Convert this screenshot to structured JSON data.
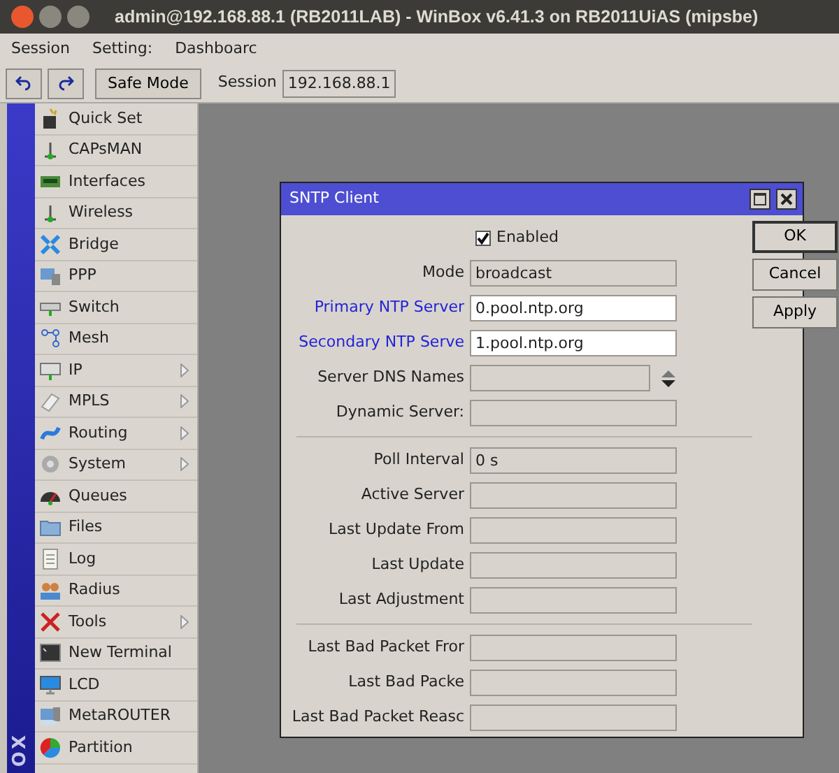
{
  "window": {
    "title": "admin@192.168.88.1 (RB2011LAB) - WinBox v6.41.3 on RB2011UiAS (mipsbe)"
  },
  "menu_bar": [
    "Session",
    "Setting:",
    "Dashboarc"
  ],
  "toolbar": {
    "safe_mode": "Safe Mode",
    "session_label": "Session",
    "session_value": "192.168.88.1"
  },
  "side_strip": {
    "text": "OX"
  },
  "sidebar": {
    "items": [
      {
        "label": "Quick Set",
        "submenu": false
      },
      {
        "label": "CAPsMAN",
        "submenu": false
      },
      {
        "label": "Interfaces",
        "submenu": false
      },
      {
        "label": "Wireless",
        "submenu": false
      },
      {
        "label": "Bridge",
        "submenu": false
      },
      {
        "label": "PPP",
        "submenu": false
      },
      {
        "label": "Switch",
        "submenu": false
      },
      {
        "label": "Mesh",
        "submenu": false
      },
      {
        "label": "IP",
        "submenu": true
      },
      {
        "label": "MPLS",
        "submenu": true
      },
      {
        "label": "Routing",
        "submenu": true
      },
      {
        "label": "System",
        "submenu": true
      },
      {
        "label": "Queues",
        "submenu": false
      },
      {
        "label": "Files",
        "submenu": false
      },
      {
        "label": "Log",
        "submenu": false
      },
      {
        "label": "Radius",
        "submenu": false
      },
      {
        "label": "Tools",
        "submenu": true
      },
      {
        "label": "New Terminal",
        "submenu": false
      },
      {
        "label": "LCD",
        "submenu": false
      },
      {
        "label": "MetaROUTER",
        "submenu": false
      },
      {
        "label": "Partition",
        "submenu": false
      }
    ]
  },
  "dialog": {
    "title": "SNTP Client",
    "enabled": {
      "label": "Enabled",
      "checked": true
    },
    "groups": [
      [
        {
          "label": "Mode",
          "value": "broadcast",
          "editable": false,
          "highlighted": false,
          "kind": "text"
        },
        {
          "label": "Primary NTP Server",
          "value": "0.pool.ntp.org",
          "editable": true,
          "highlighted": true,
          "kind": "text"
        },
        {
          "label": "Secondary NTP Serve",
          "value": "1.pool.ntp.org",
          "editable": true,
          "highlighted": true,
          "kind": "text"
        },
        {
          "label": "Server DNS Names",
          "editable": false,
          "highlighted": false,
          "kind": "list"
        },
        {
          "label": "Dynamic Server:",
          "editable": false,
          "highlighted": false,
          "kind": "text"
        }
      ],
      [
        {
          "label": "Poll Interval",
          "value": "0 s",
          "editable": false,
          "highlighted": false,
          "kind": "text"
        },
        {
          "label": "Active Server",
          "editable": false,
          "highlighted": false,
          "kind": "text"
        },
        {
          "label": "Last Update From",
          "editable": false,
          "highlighted": false,
          "kind": "text"
        },
        {
          "label": "Last Update",
          "editable": false,
          "highlighted": false,
          "kind": "text"
        },
        {
          "label": "Last Adjustment",
          "editable": false,
          "highlighted": false,
          "kind": "text"
        }
      ],
      [
        {
          "label": "Last Bad Packet Fror",
          "editable": false,
          "highlighted": false,
          "kind": "text"
        },
        {
          "label": "Last Bad Packe",
          "editable": false,
          "highlighted": false,
          "kind": "text"
        },
        {
          "label": "Last Bad Packet Reasc",
          "editable": false,
          "highlighted": false,
          "kind": "text"
        }
      ]
    ],
    "buttons": [
      "OK",
      "Cancel",
      "Apply"
    ]
  }
}
